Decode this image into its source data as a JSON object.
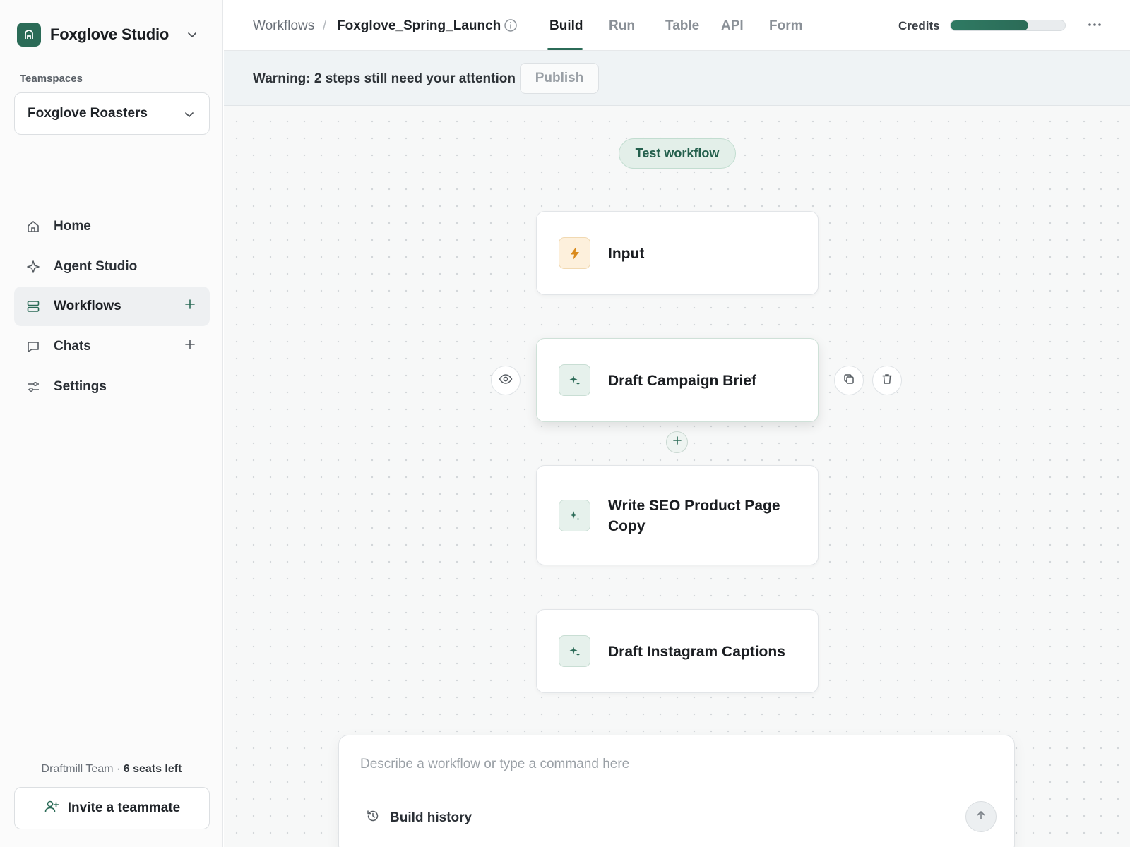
{
  "sidebar": {
    "brand": "Foxglove Studio",
    "teamspaces_label": "Teamspaces",
    "teamspace_selected": "Foxglove Roasters",
    "items": [
      {
        "label": "Home"
      },
      {
        "label": "Agent Studio"
      },
      {
        "label": "Workflows"
      },
      {
        "label": "Chats"
      },
      {
        "label": "Settings"
      }
    ],
    "team_name": "Draftmill Team",
    "seats_left": "6 seats left",
    "invite_label": "Invite a teammate"
  },
  "header": {
    "breadcrumb_root": "Workflows",
    "breadcrumb_separator": "/",
    "workflow_name": "Foxglove_Spring_Launch",
    "tabs": [
      {
        "label": "Build",
        "active": true
      },
      {
        "label": "Run"
      },
      {
        "label": "Table"
      },
      {
        "label": "API"
      },
      {
        "label": "Form"
      }
    ],
    "credits_label": "Credits",
    "credits_used_fraction": 0.68
  },
  "warning": {
    "text": "Warning: 2 steps still need your attention",
    "publish_label": "Publish"
  },
  "canvas": {
    "test_workflow_label": "Test workflow",
    "nodes": [
      {
        "title": "Input",
        "icon": "lightning-icon"
      },
      {
        "title": "Draft Campaign Brief",
        "icon": "sparkle-icon"
      },
      {
        "title": "Write SEO Product Page Copy",
        "icon": "sparkle-icon"
      },
      {
        "title": "Draft Instagram Captions",
        "icon": "sparkle-icon"
      }
    ]
  },
  "command": {
    "placeholder": "Describe a workflow or type a command here",
    "build_history_label": "Build history"
  },
  "colors": {
    "accent": "#2b6b57",
    "trigger_bg": "#fdf0dc",
    "ai_bg": "#e6f1ec"
  }
}
